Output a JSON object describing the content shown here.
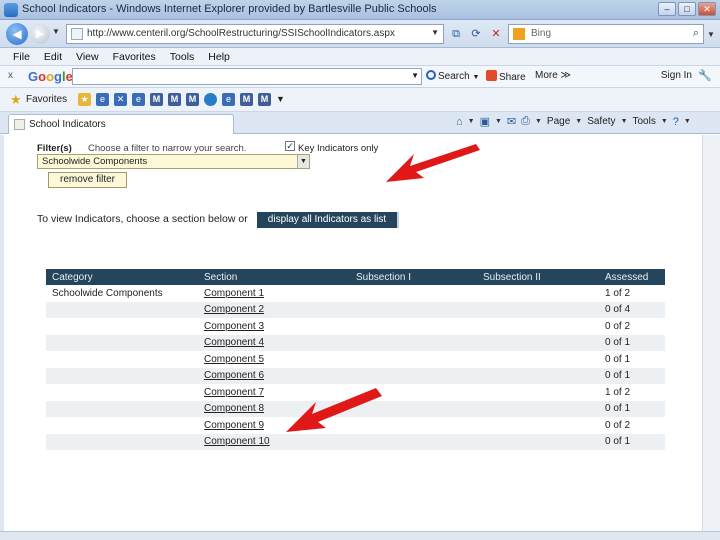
{
  "window": {
    "title": "School Indicators - Windows Internet Explorer provided by Bartlesville Public Schools",
    "controls": [
      "–",
      "□",
      "✕"
    ]
  },
  "address": {
    "url": "http://www.centeril.org/SchoolRestructuring/SSISchoolIndicators.aspx",
    "search_placeholder": "Bing"
  },
  "menu": [
    "File",
    "Edit",
    "View",
    "Favorites",
    "Tools",
    "Help"
  ],
  "google_toolbar": {
    "close": "x",
    "logo": "Google",
    "search_label": "Search",
    "share_label": "Share",
    "more_label": "More ≫",
    "signin_label": "Sign In"
  },
  "favorites": {
    "label": "Favorites"
  },
  "tab": {
    "label": "School Indicators"
  },
  "commands": {
    "page": "Page",
    "safety": "Safety",
    "tools": "Tools"
  },
  "filter": {
    "label": "Filter(s)",
    "hint": "Choose a filter to narrow your search.",
    "key_indicators_label": "Key Indicators only",
    "key_indicators_checked": true,
    "selected": "Schoolwide Components",
    "remove_label": "remove filter"
  },
  "view": {
    "text": "To view Indicators, choose a section below or",
    "display_all_label": "display all Indicators as list"
  },
  "table": {
    "headers": [
      "Category",
      "Section",
      "Subsection I",
      "Subsection II",
      "Assessed"
    ],
    "rows": [
      [
        "Schoolwide Components",
        "Component 1",
        "",
        "",
        "1 of 2"
      ],
      [
        "",
        "Component 2",
        "",
        "",
        "0 of 4"
      ],
      [
        "",
        "Component 3",
        "",
        "",
        "0 of 2"
      ],
      [
        "",
        "Component 4",
        "",
        "",
        "0 of 1"
      ],
      [
        "",
        "Component 5",
        "",
        "",
        "0 of 1"
      ],
      [
        "",
        "Component 6",
        "",
        "",
        "0 of 1"
      ],
      [
        "",
        "Component 7",
        "",
        "",
        "1 of 2"
      ],
      [
        "",
        "Component 8",
        "",
        "",
        "0 of 1"
      ],
      [
        "",
        "Component 9",
        "",
        "",
        "0 of 2"
      ],
      [
        "",
        "Component 10",
        "",
        "",
        "0 of 1"
      ]
    ]
  },
  "colors": {
    "header_bg": "#24455c",
    "arrow_red": "#e01818",
    "select_bg": "#fdf9d8"
  }
}
